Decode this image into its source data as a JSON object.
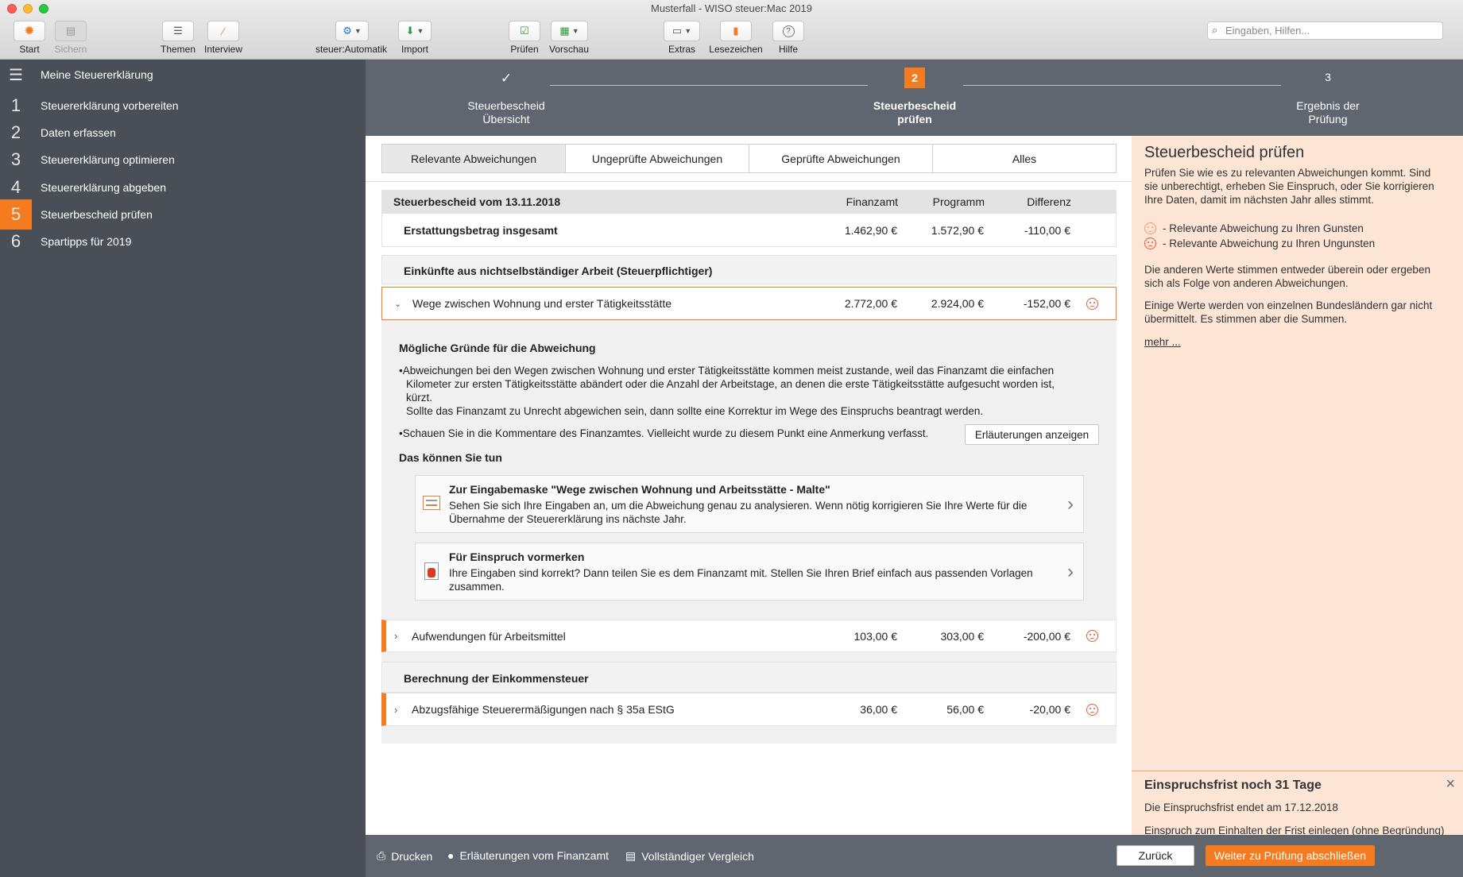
{
  "window": {
    "title": "Musterfall - WISO steuer:Mac 2019"
  },
  "toolbar": {
    "start": "Start",
    "sichern": "Sichern",
    "themen": "Themen",
    "interview": "Interview",
    "automatik": "steuer:Automatik",
    "import": "Import",
    "pruefen": "Prüfen",
    "vorschau": "Vorschau",
    "extras": "Extras",
    "lesezeichen": "Lesezeichen",
    "hilfe": "Hilfe",
    "search_placeholder": "Eingaben, Hilfen..."
  },
  "sidebar": {
    "header": "Meine Steuererklärung",
    "items": [
      {
        "num": "1",
        "label": "Steuererklärung vorbereiten"
      },
      {
        "num": "2",
        "label": "Daten erfassen"
      },
      {
        "num": "3",
        "label": "Steuererklärung optimieren"
      },
      {
        "num": "4",
        "label": "Steuererklärung abgeben"
      },
      {
        "num": "5",
        "label": "Steuerbescheid prüfen"
      },
      {
        "num": "6",
        "label": "Spartipps für 2019"
      }
    ]
  },
  "stepper": {
    "steps": [
      {
        "marker": "✓",
        "line1": "Steuerbescheid",
        "line2": "Übersicht"
      },
      {
        "marker": "2",
        "line1": "Steuerbescheid",
        "line2": "prüfen"
      },
      {
        "marker": "3",
        "line1": "Ergebnis der",
        "line2": "Prüfung"
      }
    ]
  },
  "tabs": [
    "Relevante Abweichungen",
    "Ungeprüfte Abweichungen",
    "Geprüfte Abweichungen",
    "Alles"
  ],
  "table": {
    "header": {
      "title": "Steuerbescheid vom 13.11.2018",
      "col1": "Finanzamt",
      "col2": "Programm",
      "col3": "Differenz"
    },
    "total": {
      "label": "Erstattungsbetrag insgesamt",
      "finanzamt": "1.462,90 €",
      "programm": "1.572,90 €",
      "differenz": "-110,00 €"
    },
    "section1": "Einkünfte aus nichtselbständiger Arbeit (Steuerpflichtiger)",
    "row_wege": {
      "label": "Wege zwischen Wohnung und erster Tätigkeitsstätte",
      "finanzamt": "2.772,00 €",
      "programm": "2.924,00 €",
      "differenz": "-152,00 €"
    },
    "details": {
      "reasons_title": "Mögliche Gründe für die Abweichung",
      "reason1_a": "•Abweichungen bei den Wegen zwischen Wohnung und erster Tätigkeitsstätte kommen meist zustande, weil das Finanzamt die einfachen",
      "reason1_b": "Kilometer zur ersten Tätigkeitsstätte abändert oder die Anzahl der Arbeitstage, an denen die erste Tätigkeitsstätte aufgesucht worden ist,",
      "reason1_c": "kürzt.",
      "reason1_d": "Sollte das Finanzamt zu Unrecht abgewichen sein, dann sollte eine Korrektur im Wege des Einspruchs beantragt werden.",
      "reason2": "•Schauen Sie in die Kommentare des Finanzamtes. Vielleicht wurde zu diesem Punkt eine Anmerkung verfasst.",
      "explain_button": "Erläuterungen anzeigen",
      "todo_title": "Das können Sie tun",
      "action1_title": "Zur Eingabemaske \"Wege zwischen Wohnung und Arbeitsstätte - Malte\"",
      "action1_text1": "Sehen Sie sich Ihre Eingaben an, um die Abweichung genau zu analysieren. Wenn nötig korrigieren Sie Ihre Werte für die",
      "action1_text2": "Übernahme der Steuererklärung ins nächste Jahr.",
      "action2_title": "Für Einspruch vormerken",
      "action2_text1": "Ihre Eingaben sind korrekt? Dann teilen Sie es dem Finanzamt mit. Stellen Sie Ihren Brief einfach aus passenden Vorlagen",
      "action2_text2": "zusammen."
    },
    "row_arbeitsmittel": {
      "label": "Aufwendungen für Arbeitsmittel",
      "finanzamt": "103,00 €",
      "programm": "303,00 €",
      "differenz": "-200,00 €"
    },
    "section2": "Berechnung der Einkommensteuer",
    "row_35a": {
      "label": "Abzugsfähige Steuerermäßigungen nach § 35a EStG",
      "finanzamt": "36,00 €",
      "programm": "56,00 €",
      "differenz": "-20,00 €"
    }
  },
  "right_panel": {
    "title": "Steuerbescheid prüfen",
    "intro1": "Prüfen Sie wie es zu relevanten Abweichungen kommt. Sind",
    "intro2": "sie unberechtigt, erheben Sie Einspruch, oder Sie korrigieren",
    "intro3": "Ihre Daten, damit im nächsten Jahr alles stimmt.",
    "legend_good": "- Relevante Abweichung zu Ihren Gunsten",
    "legend_bad": "- Relevante Abweichung zu Ihren Ungunsten",
    "para2_1": "Die anderen Werte stimmen entweder überein oder ergeben",
    "para2_2": "sich als Folge von anderen Abweichungen.",
    "para3_1": "Einige Werte werden von einzelnen Bundesländern gar nicht",
    "para3_2": "übermittelt. Es stimmen aber die Summen.",
    "more": "mehr ...",
    "deadline_title": "Einspruchsfrist noch 31 Tage",
    "deadline_text": "Die Einspruchsfrist endet am 17.12.2018",
    "deadline_link": "Einspruch zum Einhalten der Frist einlegen (ohne Begründung)"
  },
  "bottom": {
    "print": "Drucken",
    "explanations": "Erläuterungen vom Finanzamt",
    "compare": "Vollständiger Vergleich",
    "back": "Zurück",
    "finish": "Weiter zu Prüfung abschließen"
  },
  "colors": {
    "accent": "#f47b20",
    "sidebar": "#4a4f57",
    "stepper": "#606670",
    "right_panel": "#fde5d5"
  }
}
